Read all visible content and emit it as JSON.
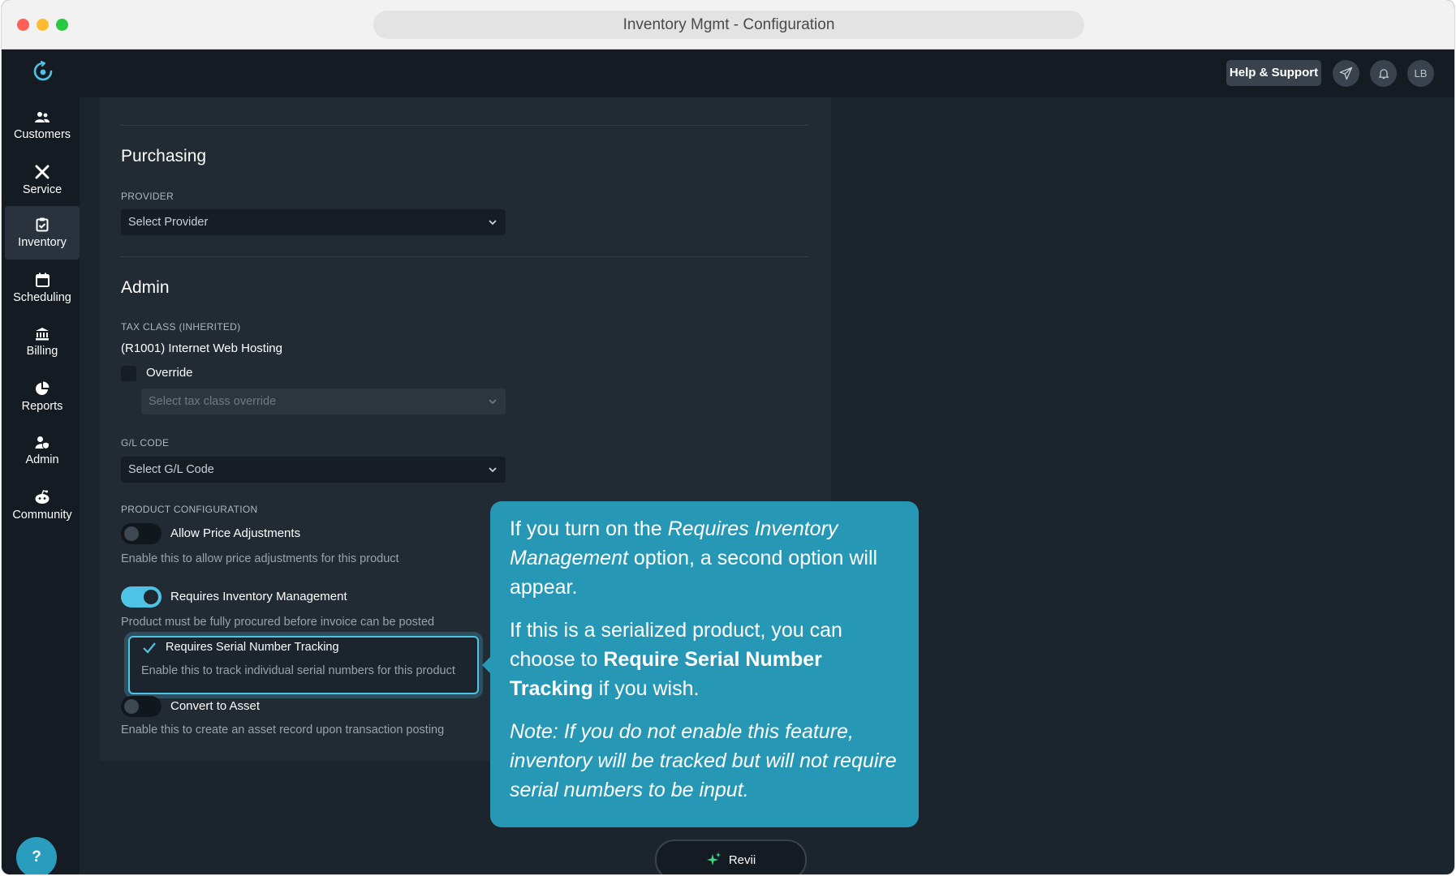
{
  "window": {
    "title": "Inventory Mgmt - Configuration"
  },
  "header": {
    "help_label": "Help & Support",
    "avatar_initials": "LB"
  },
  "sidebar": {
    "items": [
      {
        "label": "Customers",
        "icon": "users-icon"
      },
      {
        "label": "Service",
        "icon": "tools-icon"
      },
      {
        "label": "Inventory",
        "icon": "clipboard-check-icon",
        "active": true
      },
      {
        "label": "Scheduling",
        "icon": "calendar-icon"
      },
      {
        "label": "Billing",
        "icon": "bank-icon"
      },
      {
        "label": "Reports",
        "icon": "pie-chart-icon"
      },
      {
        "label": "Admin",
        "icon": "user-shield-icon"
      },
      {
        "label": "Community",
        "icon": "community-icon"
      }
    ],
    "help_fab": "?"
  },
  "purchasing": {
    "title": "Purchasing",
    "provider_label": "PROVIDER",
    "provider_value": "Select Provider"
  },
  "admin": {
    "title": "Admin",
    "tax_class_label": "TAX CLASS (INHERITED)",
    "tax_class_value": "(R1001) Internet Web Hosting",
    "override_label": "Override",
    "tax_override_placeholder": "Select tax class override",
    "gl_code_label": "G/L CODE",
    "gl_code_value": "Select G/L Code",
    "product_config_label": "PRODUCT CONFIGURATION",
    "allow_price": {
      "label": "Allow Price Adjustments",
      "help": "Enable this to allow price adjustments for this product",
      "on": false
    },
    "requires_inventory": {
      "label": "Requires Inventory Management",
      "help": "Product must be fully procured before invoice can be posted",
      "on": true
    },
    "serial_tracking": {
      "label": "Requires Serial Number Tracking",
      "help": "Enable this to track individual serial numbers for this product",
      "checked": true
    },
    "convert_asset": {
      "label": "Convert to Asset",
      "help": "Enable this to create an asset record upon transaction posting",
      "on": false
    }
  },
  "callout": {
    "p1_a": "If you turn on the ",
    "p1_em": "Requires Inventory Management",
    "p1_b": " option, a second option will appear.",
    "p2_a": "If this is a serialized product, you can choose to ",
    "p2_strong": "Require Serial Number Tracking",
    "p2_b": " if you wish.",
    "p3_em": "Note: If you do not enable this feature, inventory will be tracked but will not require serial numbers to be input."
  },
  "assistant": {
    "label": "Revii"
  },
  "colors": {
    "accent": "#4fc3e6",
    "callout": "#2797b6",
    "panel": "#222a33",
    "sidebar": "#141b22"
  }
}
